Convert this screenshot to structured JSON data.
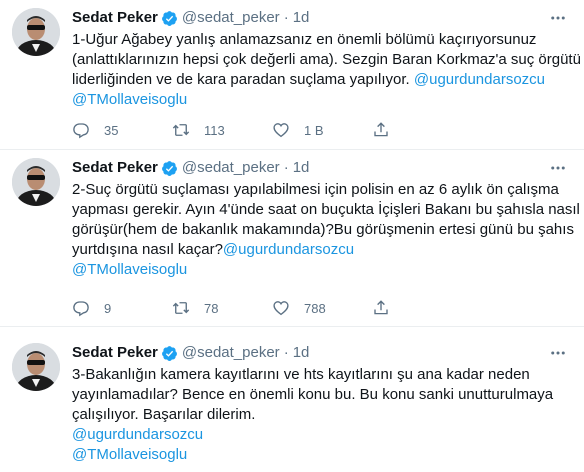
{
  "tweets": [
    {
      "name": "Sedat Peker",
      "handle": "@sedat_peker",
      "separator": "·",
      "time": "1d",
      "lines": [
        "1-Uğur Ağabey yanlış anlamazsanız en önemli bölümü kaçırıyorsunuz",
        "(anlattıklarınızın hepsi çok değerli ama). Sezgin Baran Korkmaz'a suç örgütü",
        "liderliğinden ve de kara paradan suçlama yapılıyor."
      ],
      "inline_mention": "@ugurdundarsozcu",
      "extra_mentions": [
        "@TMollaveisoglu"
      ],
      "replies": "35",
      "retweets": "113",
      "likes": "1 B"
    },
    {
      "name": "Sedat Peker",
      "handle": "@sedat_peker",
      "separator": "·",
      "time": "1d",
      "lines": [
        "2-Suç örgütü suçlaması yapılabilmesi için polisin en az 6 aylık ön çalışma",
        "yapması gerekir. Ayın 4'ünde saat on buçukta İçişleri Bakanı bu şahısla nasıl",
        "görüşür(hem de bakanlık makamında)?Bu görüşmenin ertesi günü bu şahıs",
        "yurtdışına nasıl kaçar?"
      ],
      "inline_mention": "@ugurdundarsozcu",
      "extra_mentions": [
        "@TMollaveisoglu"
      ],
      "replies": "9",
      "retweets": "78",
      "likes": "788"
    },
    {
      "name": "Sedat Peker",
      "handle": "@sedat_peker",
      "separator": "·",
      "time": "1d",
      "lines": [
        "3-Bakanlığın kamera kayıtlarını ve hts kayıtlarını şu ana kadar neden",
        "yayınlamadılar? Bence en önemli konu bu. Bu konu sanki unutturulmaya",
        "çalışılıyor. Başarılar dilerim."
      ],
      "inline_mention": "",
      "extra_mentions": [
        "@ugurdundarsozcu",
        "@TMollaveisoglu"
      ]
    }
  ],
  "colors": {
    "text": "#0f1419",
    "secondary": "#5b7083",
    "link": "#1b95e0",
    "verified": "#1da1f2",
    "border": "#ebeef0"
  },
  "icons": [
    "verified-badge-icon",
    "more-icon",
    "reply-icon",
    "retweet-icon",
    "like-icon",
    "share-icon"
  ]
}
